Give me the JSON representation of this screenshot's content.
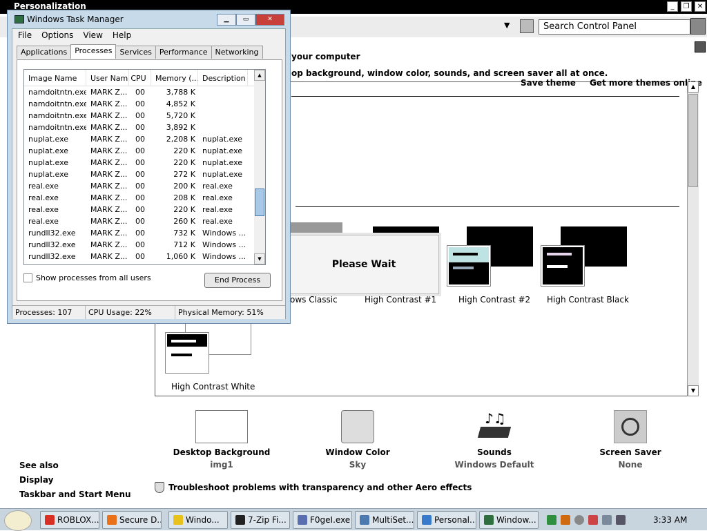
{
  "background_window": {
    "title": "Personalization",
    "search_placeholder": "Search Control Panel",
    "heading": "your computer",
    "subheading": "op background, window color, sounds, and screen saver all at once.",
    "save_theme": "Save theme",
    "get_more": "Get more themes online",
    "themes": [
      {
        "label": "ows Classic"
      },
      {
        "label": "High Contrast #1"
      },
      {
        "label": "High Contrast #2"
      },
      {
        "label": "High Contrast Black"
      },
      {
        "label": "High Contrast White"
      }
    ],
    "please_wait": "Please Wait",
    "bottom": [
      {
        "label": "Desktop Background",
        "value": "img1"
      },
      {
        "label": "Window Color",
        "value": "Sky"
      },
      {
        "label": "Sounds",
        "value": "Windows Default"
      },
      {
        "label": "Screen Saver",
        "value": "None"
      }
    ],
    "see_also": {
      "title": "See also",
      "items": [
        "Display",
        "Taskbar and Start Menu"
      ]
    },
    "troubleshoot": "Troubleshoot problems with transparency and other Aero effects"
  },
  "task_manager": {
    "title": "Windows Task Manager",
    "menu": [
      "File",
      "Options",
      "View",
      "Help"
    ],
    "tabs": [
      "Applications",
      "Processes",
      "Services",
      "Performance",
      "Networking"
    ],
    "active_tab": "Processes",
    "columns": [
      "Image Name",
      "User Name",
      "CPU",
      "Memory (...",
      "Description"
    ],
    "rows": [
      [
        "namdoitntn.exe",
        "MARK Z...",
        "00",
        "3,788 K",
        ""
      ],
      [
        "namdoitntn.exe",
        "MARK Z...",
        "00",
        "4,852 K",
        ""
      ],
      [
        "namdoitntn.exe",
        "MARK Z...",
        "00",
        "5,720 K",
        ""
      ],
      [
        "namdoitntn.exe",
        "MARK Z...",
        "00",
        "3,892 K",
        ""
      ],
      [
        "nuplat.exe",
        "MARK Z...",
        "00",
        "2,208 K",
        "nuplat.exe"
      ],
      [
        "nuplat.exe",
        "MARK Z...",
        "00",
        "220 K",
        "nuplat.exe"
      ],
      [
        "nuplat.exe",
        "MARK Z...",
        "00",
        "220 K",
        "nuplat.exe"
      ],
      [
        "nuplat.exe",
        "MARK Z...",
        "00",
        "272 K",
        "nuplat.exe"
      ],
      [
        "real.exe",
        "MARK Z...",
        "00",
        "200 K",
        "real.exe"
      ],
      [
        "real.exe",
        "MARK Z...",
        "00",
        "208 K",
        "real.exe"
      ],
      [
        "real.exe",
        "MARK Z...",
        "00",
        "220 K",
        "real.exe"
      ],
      [
        "real.exe",
        "MARK Z...",
        "00",
        "260 K",
        "real.exe"
      ],
      [
        "rundll32.exe",
        "MARK Z...",
        "00",
        "732 K",
        "Windows ..."
      ],
      [
        "rundll32.exe",
        "MARK Z...",
        "00",
        "712 K",
        "Windows ..."
      ],
      [
        "rundll32.exe",
        "MARK Z...",
        "00",
        "1,060 K",
        "Windows ..."
      ]
    ],
    "show_all_label": "Show processes from all users",
    "end_process": "End Process",
    "status": {
      "processes": "Processes: 107",
      "cpu": "CPU Usage: 22%",
      "memory": "Physical Memory: 51%"
    }
  },
  "taskbar": {
    "buttons": [
      {
        "label": "ROBLOX...",
        "color": "#d93025"
      },
      {
        "label": "Secure D...",
        "color": "#e8711a"
      },
      {
        "label": "Windo...",
        "color": "#e8c21a"
      },
      {
        "label": "7-Zip Fi...",
        "color": "#222222"
      },
      {
        "label": "F0geI.exe",
        "color": "#5a6fb0"
      },
      {
        "label": "MultiSet...",
        "color": "#4a7ab0"
      },
      {
        "label": "Personal...",
        "color": "#3a7acb"
      },
      {
        "label": "Window...",
        "color": "#2f6f3f"
      }
    ],
    "clock": "3:33 AM"
  }
}
